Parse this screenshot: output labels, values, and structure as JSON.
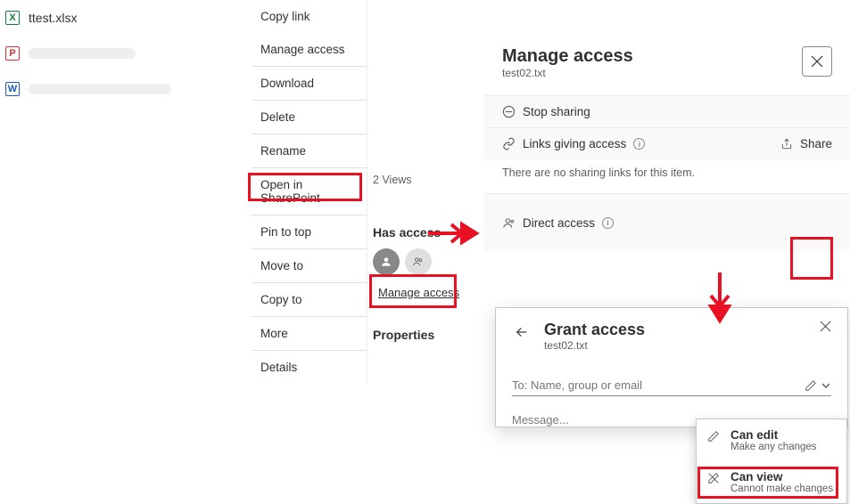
{
  "files": [
    {
      "name": "ttest.xlsx",
      "type": "xlsx"
    },
    {
      "name": "",
      "type": "pdf"
    },
    {
      "name": "",
      "type": "docx"
    }
  ],
  "context_menu": {
    "items": [
      "Copy link",
      "Manage access",
      "Download",
      "Delete",
      "Rename",
      "Open in SharePoint",
      "Pin to top",
      "Move to",
      "Copy to",
      "More",
      "Details"
    ]
  },
  "mid": {
    "views": "2 Views",
    "has_access": "Has access",
    "manage_access": "Manage access",
    "properties": "Properties"
  },
  "panel": {
    "title": "Manage access",
    "file": "test02.txt",
    "stop_sharing": "Stop sharing",
    "links_giving_access": "Links giving access",
    "share": "Share",
    "no_links": "There are no sharing links for this item.",
    "direct_access": "Direct access"
  },
  "popup": {
    "title": "Grant access",
    "file": "test02.txt",
    "to_placeholder": "To: Name, group or email",
    "message_placeholder": "Message..."
  },
  "perm": {
    "edit_title": "Can edit",
    "edit_sub": "Make any changes",
    "view_title": "Can view",
    "view_sub": "Cannot make changes"
  }
}
